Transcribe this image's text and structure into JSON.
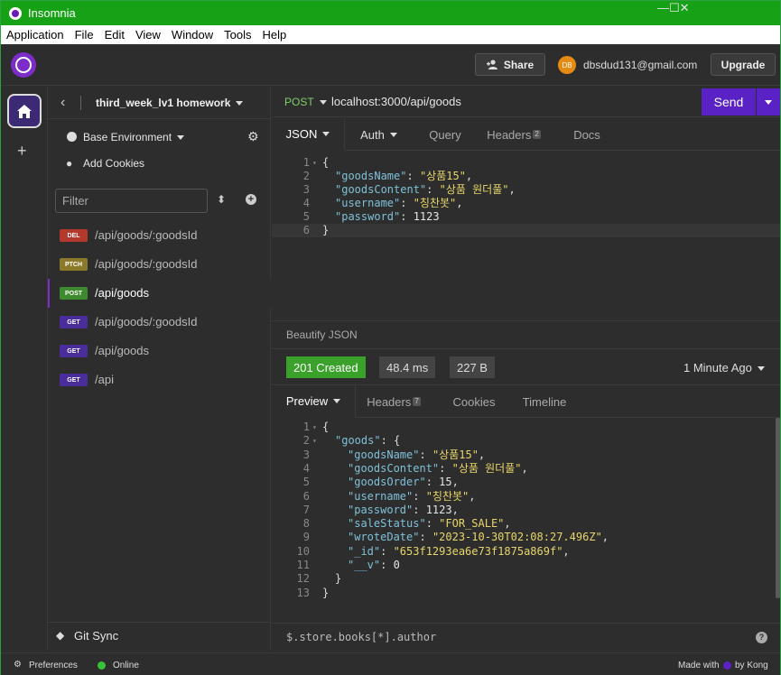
{
  "window": {
    "title": "Insomnia",
    "controls": {
      "minimize": "—",
      "maximize": "☐",
      "close": "✕"
    }
  },
  "menu": [
    "Application",
    "File",
    "Edit",
    "View",
    "Window",
    "Tools",
    "Help"
  ],
  "header": {
    "share_label": "Share",
    "avatar_initials": "DB",
    "email": "dbsdud131@gmail.com",
    "upgrade_label": "Upgrade"
  },
  "sidebar": {
    "project": "third_week_lv1 homework",
    "environment": "Base Environment",
    "add_cookies": "Add Cookies",
    "filter_placeholder": "Filter",
    "requests": [
      {
        "method": "DEL",
        "path": "/api/goods/:goodsId"
      },
      {
        "method": "PTCH",
        "path": "/api/goods/:goodsId"
      },
      {
        "method": "POST",
        "path": "/api/goods"
      },
      {
        "method": "GET",
        "path": "/api/goods/:goodsId"
      },
      {
        "method": "GET",
        "path": "/api/goods"
      },
      {
        "method": "GET",
        "path": "/api"
      }
    ],
    "git_sync": "Git Sync"
  },
  "request": {
    "method": "POST",
    "url": "localhost:3000/api/goods",
    "send_label": "Send",
    "tabs": {
      "json": "JSON",
      "auth": "Auth",
      "query": "Query",
      "headers": "Headers",
      "headers_count": "2",
      "docs": "Docs"
    },
    "body_lines": [
      {
        "num": "1",
        "fold": "▾",
        "text": "{"
      },
      {
        "num": "2",
        "key": "\"goodsName\"",
        "val": "\"상품15\"",
        "tail": ","
      },
      {
        "num": "3",
        "key": "\"goodsContent\"",
        "val": "\"상품 원더풀\"",
        "tail": ","
      },
      {
        "num": "4",
        "key": "\"username\"",
        "val": "\"칭찬봇\"",
        "tail": ","
      },
      {
        "num": "5",
        "key": "\"password\"",
        "val": "1123",
        "tail": ""
      },
      {
        "num": "6",
        "text": "}"
      }
    ],
    "beautify": "Beautify JSON"
  },
  "response": {
    "status": "201 Created",
    "time": "48.4 ms",
    "size": "227 B",
    "ago": "1 Minute Ago",
    "tabs": {
      "preview": "Preview",
      "headers": "Headers",
      "headers_count": "7",
      "cookies": "Cookies",
      "timeline": "Timeline"
    },
    "lines": [
      {
        "num": "1",
        "fold": "▾",
        "text": "{"
      },
      {
        "num": "2",
        "fold": "▾",
        "key": "\"goods\"",
        "after": ": {",
        "indent": 1
      },
      {
        "num": "3",
        "key": "\"goodsName\"",
        "val": "\"상품15\"",
        "tail": ",",
        "indent": 2
      },
      {
        "num": "4",
        "key": "\"goodsContent\"",
        "val": "\"상품 원더풀\"",
        "tail": ",",
        "indent": 2
      },
      {
        "num": "5",
        "key": "\"goodsOrder\"",
        "val": "15",
        "tail": ",",
        "indent": 2
      },
      {
        "num": "6",
        "key": "\"username\"",
        "val": "\"칭찬봇\"",
        "tail": ",",
        "indent": 2
      },
      {
        "num": "7",
        "key": "\"password\"",
        "val": "1123",
        "tail": ",",
        "indent": 2
      },
      {
        "num": "8",
        "key": "\"saleStatus\"",
        "val": "\"FOR_SALE\"",
        "tail": ",",
        "indent": 2
      },
      {
        "num": "9",
        "key": "\"wroteDate\"",
        "val": "\"2023-10-30T02:08:27.496Z\"",
        "tail": ",",
        "indent": 2
      },
      {
        "num": "10",
        "key": "\"_id\"",
        "val": "\"653f1293ea6e73f1875a869f\"",
        "tail": ",",
        "indent": 2
      },
      {
        "num": "11",
        "key": "\"__v\"",
        "val": "0",
        "tail": "",
        "indent": 2
      },
      {
        "num": "12",
        "text": "}",
        "indent": 1
      },
      {
        "num": "13",
        "text": "}"
      }
    ],
    "filter_query": "$.store.books[*].author"
  },
  "footer": {
    "preferences": "Preferences",
    "online": "Online",
    "made_with": "Made with",
    "by_kong": "by Kong"
  },
  "colors": {
    "titlebar": "#16a116",
    "accent": "#5a22c5",
    "success": "#3aa12a"
  }
}
